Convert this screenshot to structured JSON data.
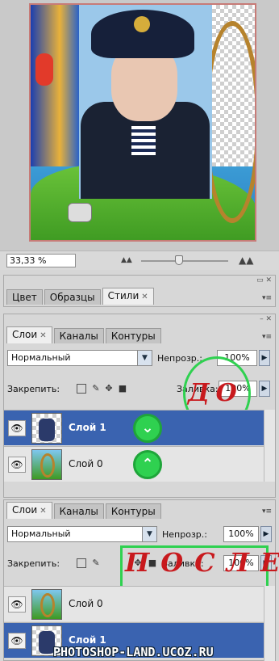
{
  "canvas": {
    "zoom": "33,33 %"
  },
  "styles_panel": {
    "tabs": [
      "Цвет",
      "Образцы",
      "Стили"
    ]
  },
  "before": {
    "tabs": [
      "Слои",
      "Каналы",
      "Контуры"
    ],
    "blend_mode": "Нормальный",
    "opacity_label": "Непрозр.:",
    "opacity_value": "100%",
    "lock_label": "Закрепить:",
    "fill_label": "Заливка:",
    "fill_value": "100%",
    "annotation": "ДО",
    "layers": [
      {
        "name": "Слой 1",
        "selected": true
      },
      {
        "name": "Слой 0",
        "selected": false
      }
    ]
  },
  "after": {
    "tabs": [
      "Слои",
      "Каналы",
      "Контуры"
    ],
    "blend_mode": "Нормальный",
    "opacity_label": "Непрозр.:",
    "opacity_value": "100%",
    "lock_label": "Закрепить:",
    "fill_label": "Заливка:",
    "fill_value": "100%",
    "annotation": "ПОСЛЕ",
    "layers": [
      {
        "name": "Слой 0",
        "selected": false
      },
      {
        "name": "Слой 1",
        "selected": true
      }
    ]
  },
  "watermark": "PHOTOSHOP-LAND.UCOZ.RU",
  "colors": {
    "selection": "#3a63b0",
    "highlight": "#2fd150",
    "annotation": "#c8191d"
  },
  "icons": [
    "eye-icon",
    "lock-transparent-icon",
    "lock-brush-icon",
    "lock-move-icon",
    "lock-all-icon",
    "arrow-down-icon",
    "arrow-up-icon",
    "close-icon",
    "panel-menu-icon",
    "zoom-small-icon",
    "zoom-large-icon"
  ]
}
